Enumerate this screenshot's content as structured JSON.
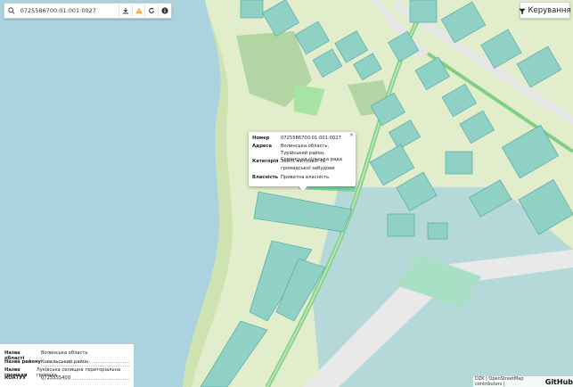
{
  "search": {
    "value": "0725586700:01:001:0027"
  },
  "toolbar": {
    "icons": [
      "download-icon",
      "warning-icon",
      "refresh-icon",
      "info-icon"
    ]
  },
  "manage": {
    "label": "Керування"
  },
  "popup": {
    "rows": [
      {
        "key": "Номер",
        "value": "0725586700:01:001:0027"
      },
      {
        "key": "Адреса",
        "value": "Волинська область, Турійський район, Соменська сільська рада"
      },
      {
        "key": "Категорія",
        "value": "Землі житлової та громадської забудови"
      },
      {
        "key": "Власність",
        "value": "Приватна власність"
      }
    ]
  },
  "info": {
    "rows": [
      {
        "key": "Назва області",
        "value": "Волинська область"
      },
      {
        "key": "Назва району",
        "value": "Ковельський район"
      },
      {
        "key": "Назва громади",
        "value": "Луківська селищна територіальна громада"
      },
      {
        "key": "КОАТУУ",
        "value": "0725555400"
      }
    ]
  },
  "attribution": {
    "text": "DZK | OpenStreetMap contributors |",
    "logo": "GitHub"
  },
  "colors": {
    "water": "#aad3df",
    "land": "#e4efc9",
    "parcels": "#9fd6c6",
    "road": "#8fd48f"
  }
}
